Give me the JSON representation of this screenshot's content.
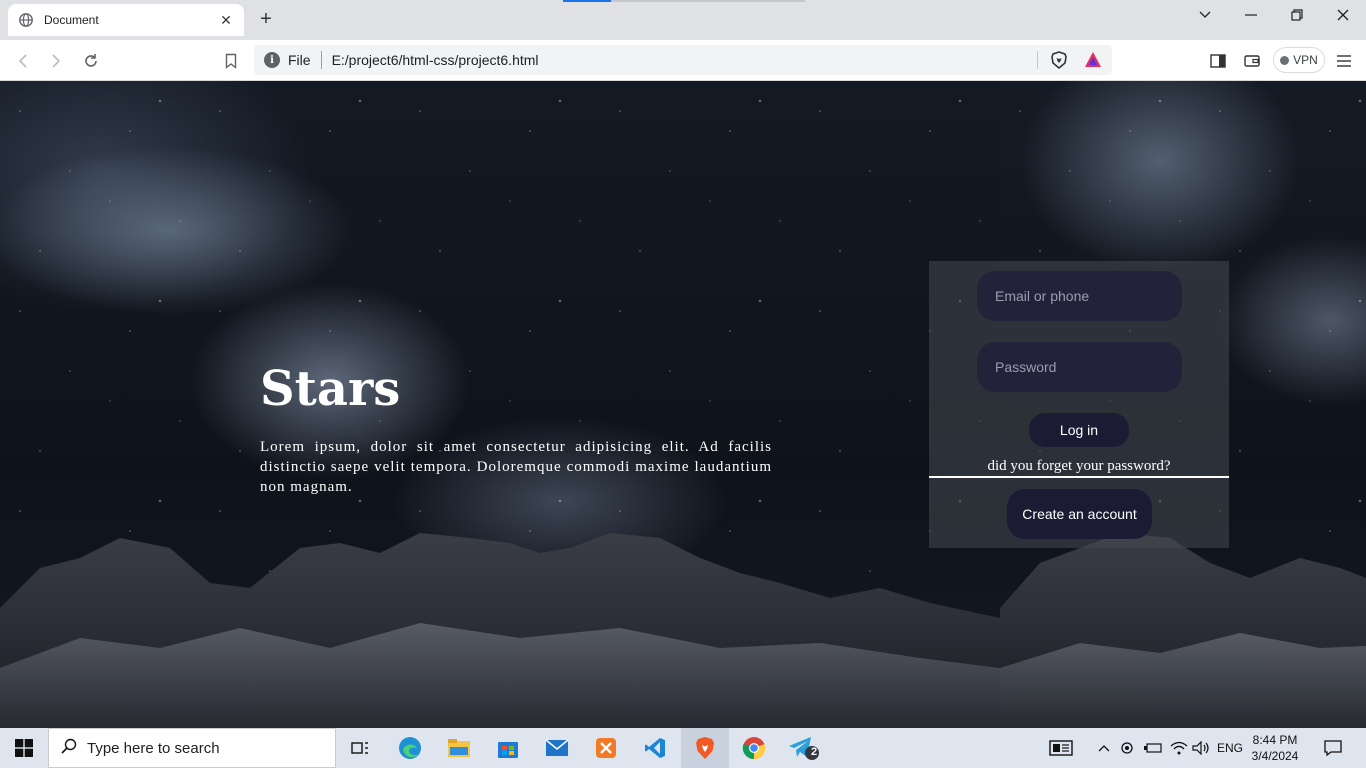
{
  "browser": {
    "tab_title": "Document",
    "address_scheme": "File",
    "address_url": "E:/project6/html-css/project6.html",
    "vpn_label": "VPN"
  },
  "page": {
    "hero_title": "Stars",
    "hero_text": "Lorem ipsum, dolor sit amet consectetur adipisicing elit. Ad facilis distinctio saepe velit tempora. Doloremque commodi maxime laudantium non magnam.",
    "email_placeholder": "Email or phone",
    "password_placeholder": "Password",
    "login_label": "Log in",
    "forgot_label": "did you forget your password?",
    "create_label": "Create an account"
  },
  "taskbar": {
    "search_placeholder": "Type here to search",
    "telegram_badge": "2",
    "language": "ENG",
    "time": "8:44 PM",
    "date": "3/4/2024"
  },
  "colors": {
    "input_bg": "#22233b",
    "button_bg": "#1b1c34",
    "panel_bg": "rgba(70,72,80,0.55)"
  }
}
